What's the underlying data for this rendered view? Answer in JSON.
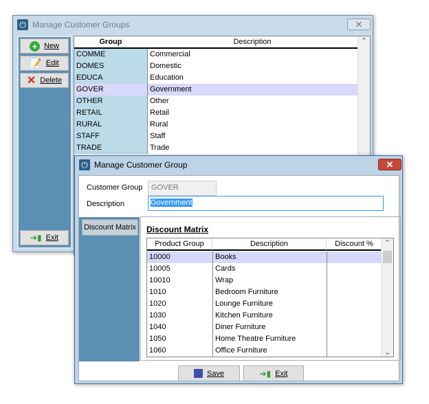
{
  "groups_window": {
    "title": "Manage Customer Groups",
    "close_glyph": "✕",
    "buttons": {
      "new": "New",
      "edit": "Edit",
      "delete": "Delete",
      "exit": "Exit"
    },
    "columns": [
      "Group",
      "Description"
    ],
    "rows": [
      {
        "group": "COMME",
        "description": "Commercial"
      },
      {
        "group": "DOMES",
        "description": "Domestic"
      },
      {
        "group": "EDUCA",
        "description": "Education"
      },
      {
        "group": "GOVER",
        "description": "Government",
        "selected": true
      },
      {
        "group": "OTHER",
        "description": "Other"
      },
      {
        "group": "RETAIL",
        "description": "Retail"
      },
      {
        "group": "RURAL",
        "description": "Rural"
      },
      {
        "group": "STAFF",
        "description": "Staff"
      },
      {
        "group": "TRADE",
        "description": "Trade"
      }
    ]
  },
  "group_dialog": {
    "title": "Manage Customer Group",
    "close_glyph": "✕",
    "customer_group_label": "Customer Group",
    "customer_group_value": "GOVER",
    "description_label": "Description",
    "description_value": "Government",
    "tab": "Discount Matrix",
    "section_heading": "Discount Matrix",
    "columns": [
      "Product Group",
      "Description",
      "Discount %"
    ],
    "rows": [
      {
        "code": "10000",
        "description": "Books",
        "discount": "",
        "selected": true
      },
      {
        "code": "10005",
        "description": "Cards",
        "discount": ""
      },
      {
        "code": "10010",
        "description": "Wrap",
        "discount": ""
      },
      {
        "code": "1010",
        "description": "Bedroom Furniture",
        "discount": ""
      },
      {
        "code": "1020",
        "description": "Lounge Furniture",
        "discount": ""
      },
      {
        "code": "1030",
        "description": "Kitchen Furniture",
        "discount": ""
      },
      {
        "code": "1040",
        "description": "Diner Furniture",
        "discount": ""
      },
      {
        "code": "1050",
        "description": "Home Theatre Furniture",
        "discount": ""
      },
      {
        "code": "1060",
        "description": "Office Furniture",
        "discount": ""
      }
    ],
    "buttons": {
      "save": "Save",
      "exit": "Exit"
    }
  },
  "colors": {
    "panel_blue": "#5b8fb4",
    "group_col": "#bcdbe9",
    "selected": "#d8d8fa",
    "title_bg": "#c9daea",
    "close_red": "#c7483a"
  }
}
